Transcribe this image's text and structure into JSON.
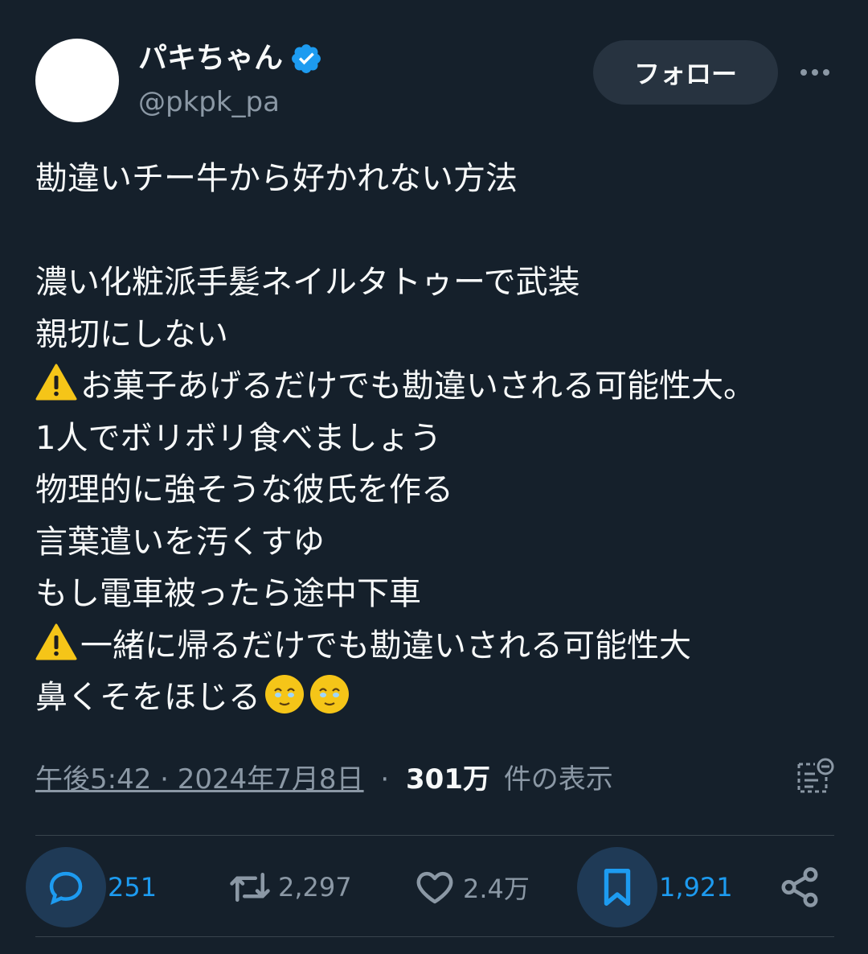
{
  "author": {
    "display_name": "パキちゃん",
    "handle": "@pkpk_pa",
    "verified": true,
    "verified_color": "#1d9bf0"
  },
  "header": {
    "follow_label": "フォロー",
    "more_icon": "more-horizontal-icon"
  },
  "tweet": {
    "lines": [
      {
        "prefix_icon": "",
        "text": "勘違いチー牛から好かれない方法",
        "suffix_icons": 0
      },
      {
        "prefix_icon": "",
        "text": "",
        "suffix_icons": 0
      },
      {
        "prefix_icon": "",
        "text": "濃い化粧派手髪ネイルタトゥーで武装",
        "suffix_icons": 0
      },
      {
        "prefix_icon": "",
        "text": "親切にしない",
        "suffix_icons": 0
      },
      {
        "prefix_icon": "warning-icon",
        "text": "お菓子あげるだけでも勘違いされる可能性大。",
        "suffix_icons": 0
      },
      {
        "prefix_icon": "",
        "text": "1人でボリボリ食べましょう",
        "suffix_icons": 0
      },
      {
        "prefix_icon": "",
        "text": "物理的に強そうな彼氏を作る",
        "suffix_icons": 0
      },
      {
        "prefix_icon": "",
        "text": "言葉遣いを汚くすゆ",
        "suffix_icons": 0
      },
      {
        "prefix_icon": "",
        "text": "もし電車被ったら途中下車",
        "suffix_icons": 0
      },
      {
        "prefix_icon": "warning-icon",
        "text": "一緒に帰るだけでも勘違いされる可能性大",
        "suffix_icons": 0
      },
      {
        "prefix_icon": "",
        "text": "鼻くそをほじる",
        "suffix_icons": 2
      }
    ],
    "suffix_emoji_icon": "face-holding-back-tears-icon"
  },
  "meta": {
    "timestamp": "午後5:42 · 2024年7月8日",
    "separator": "·",
    "views_count": "301万",
    "views_label": "件の表示",
    "analytics_icon": "analytics-icon"
  },
  "actions": {
    "reply": {
      "icon": "reply-icon",
      "count": "251",
      "active": true
    },
    "retweet": {
      "icon": "retweet-icon",
      "count": "2,297",
      "active": false
    },
    "like": {
      "icon": "heart-icon",
      "count": "2.4万",
      "active": false
    },
    "bookmark": {
      "icon": "bookmark-icon",
      "count": "1,921",
      "active": true
    },
    "share": {
      "icon": "share-icon"
    }
  },
  "colors": {
    "background": "#15202b",
    "text_primary": "#f7f9f9",
    "text_secondary": "#8b98a5",
    "accent": "#1d9bf0",
    "follow_button_bg": "#273340",
    "highlight_bg": "#1f3a56",
    "divider": "#38444d"
  }
}
